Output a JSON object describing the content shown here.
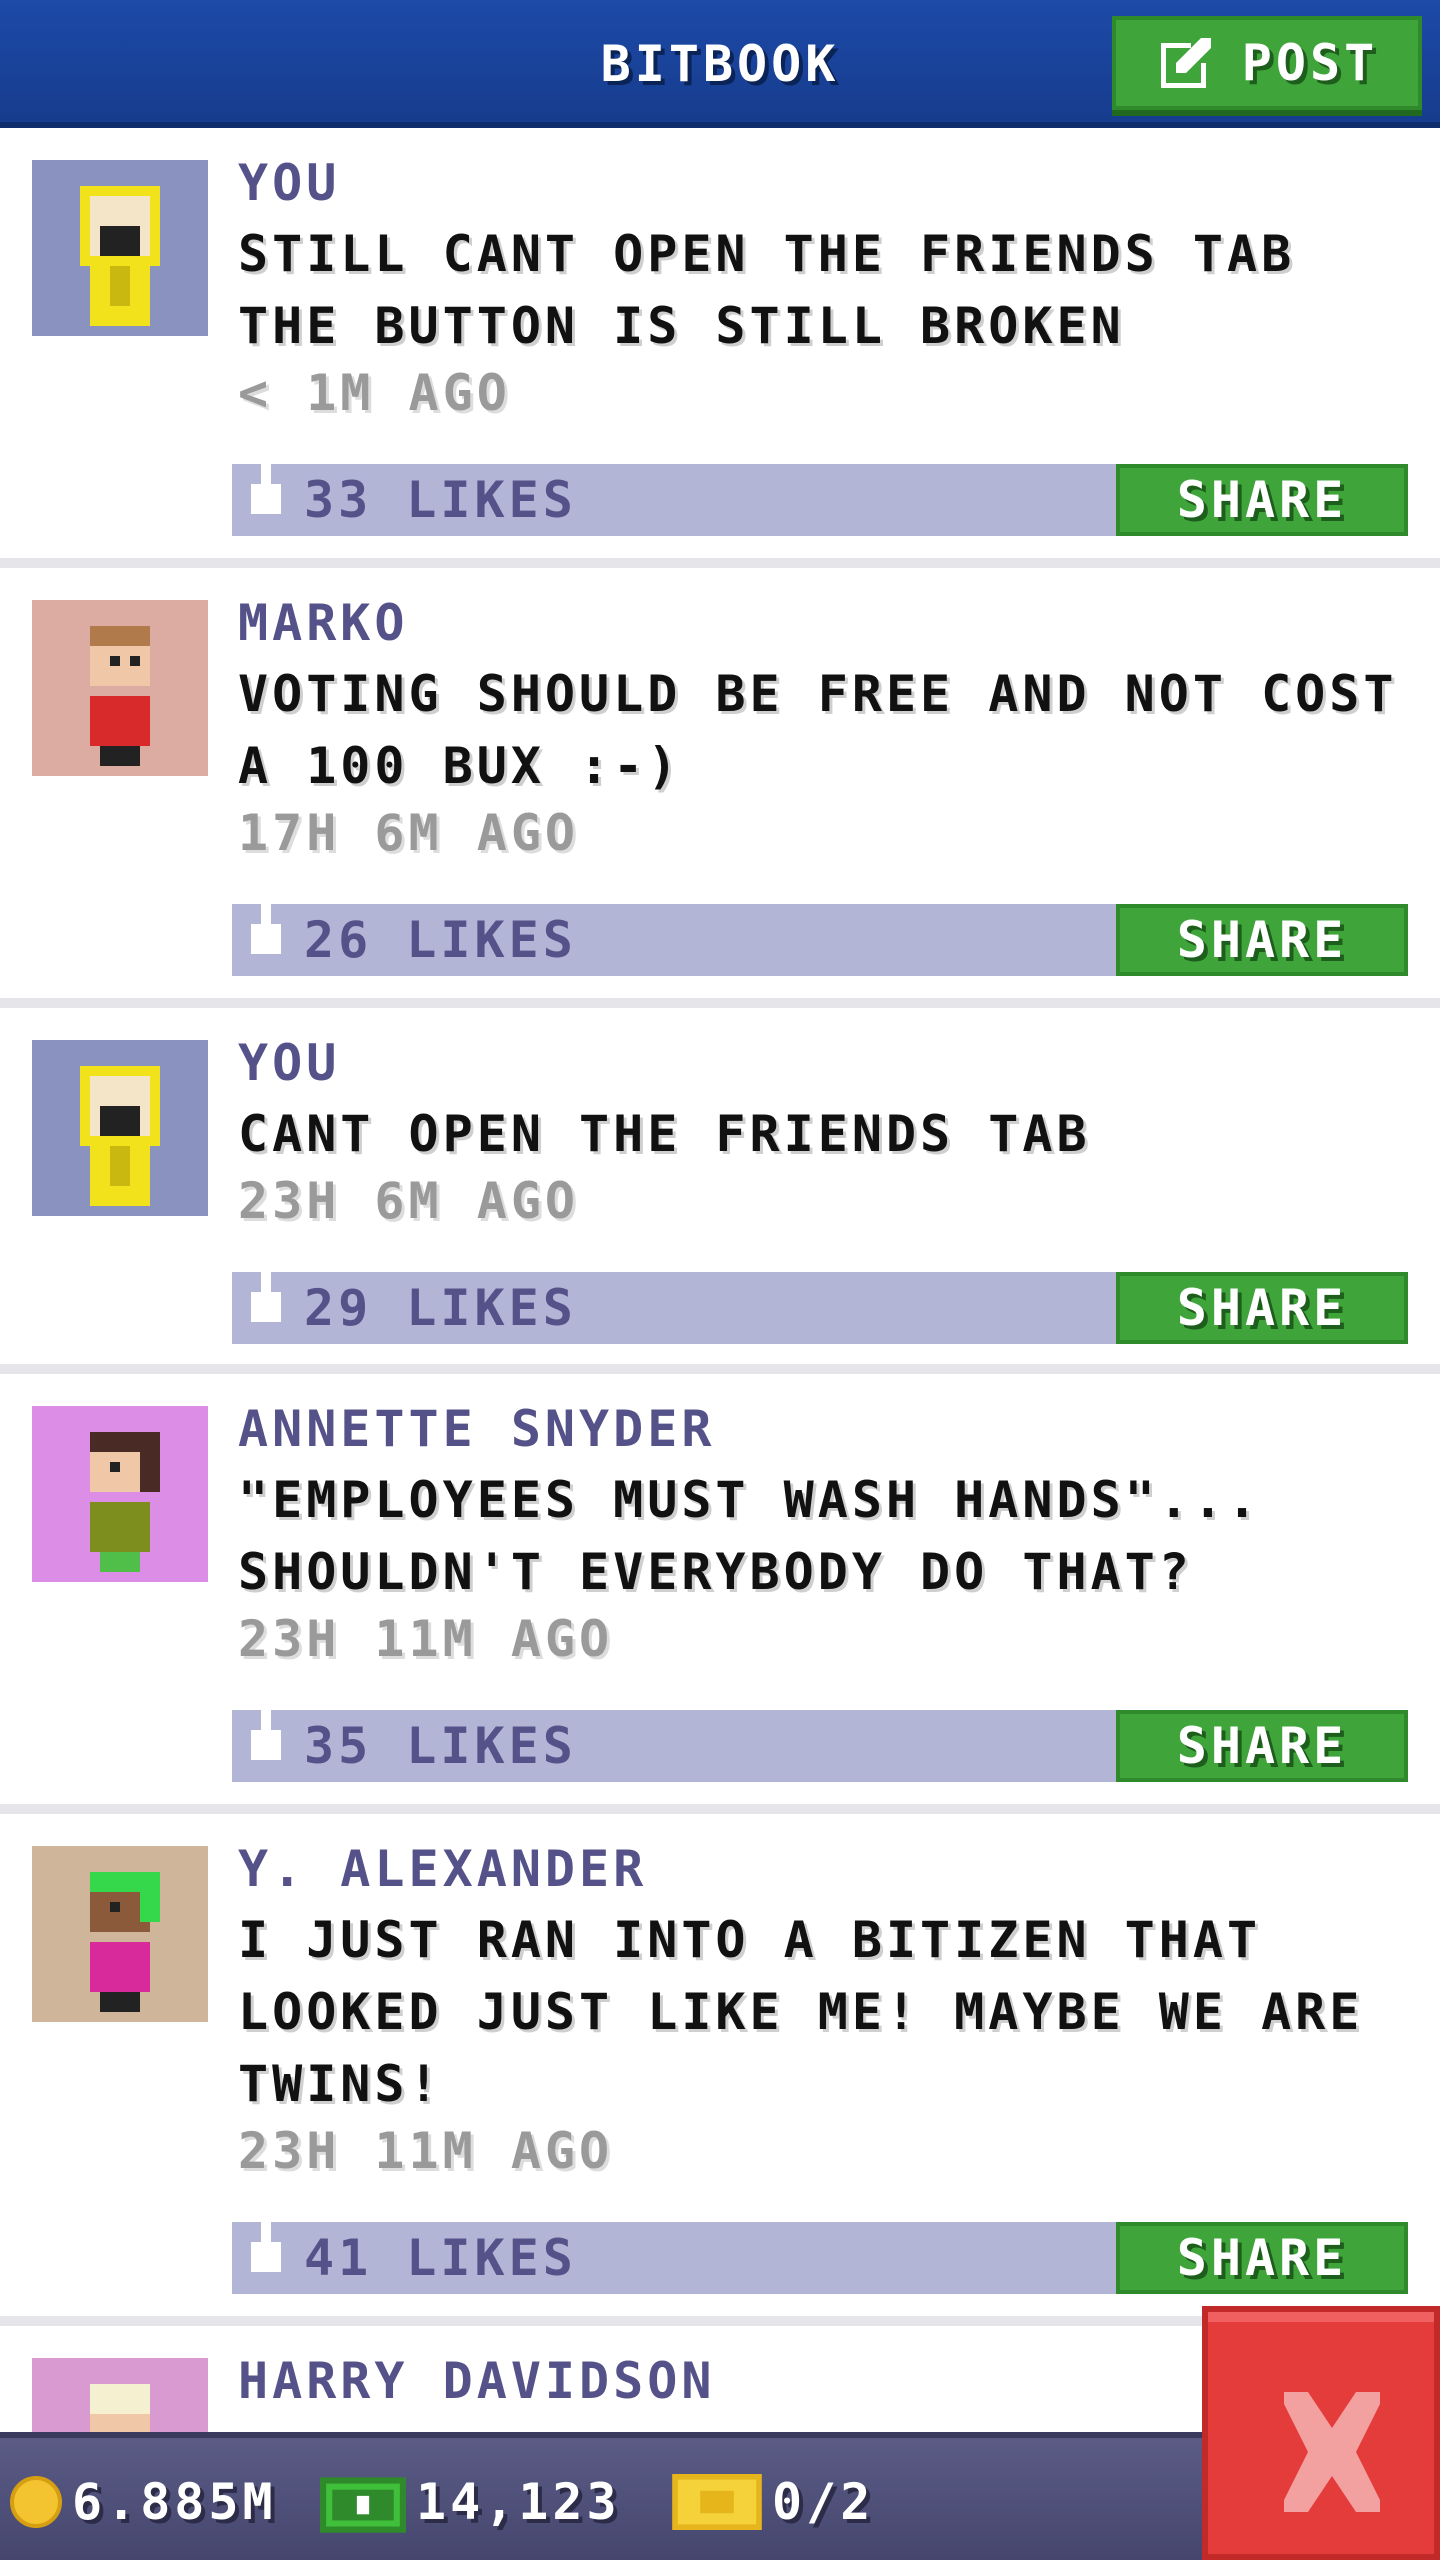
{
  "header": {
    "title": "BITBOOK",
    "post_label": "POST"
  },
  "posts": [
    {
      "author": "YOU",
      "message": "STILL CANT OPEN THE FRIENDS TAB THE BUTTON IS STILL BROKEN",
      "time": "< 1M AGO",
      "likes": "33 LIKES",
      "share": "SHARE",
      "avatar_bg": "#8a93c0"
    },
    {
      "author": "MARKO",
      "message": "VOTING SHOULD BE FREE AND NOT COST A 100 BUX :-)",
      "time": "17H 6M AGO",
      "likes": "26 LIKES",
      "share": "SHARE",
      "avatar_bg": "#dcaca3"
    },
    {
      "author": "YOU",
      "message": "CANT OPEN THE FRIENDS TAB",
      "time": "23H 6M AGO",
      "likes": "29 LIKES",
      "share": "SHARE",
      "avatar_bg": "#8a93c0"
    },
    {
      "author": "ANNETTE SNYDER",
      "message": "\"EMPLOYEES MUST WASH HANDS\"... SHOULDN'T EVERYBODY DO THAT?",
      "time": "23H 11M AGO",
      "likes": "35 LIKES",
      "share": "SHARE",
      "avatar_bg": "#dc8ee6"
    },
    {
      "author": "Y. ALEXANDER",
      "message": "I JUST RAN INTO A BITIZEN THAT LOOKED JUST LIKE ME! MAYBE WE ARE TWINS!",
      "time": "23H 11M AGO",
      "likes": "41 LIKES",
      "share": "SHARE",
      "avatar_bg": "#cfb59a"
    },
    {
      "author": "HARRY DAVIDSON",
      "avatar_bg": "#d89ad0"
    }
  ],
  "status": {
    "coins": "6.885M",
    "bux": "14,123",
    "tickets": "0/2"
  },
  "colors": {
    "header": "#1d4aa8",
    "accent_green": "#3fa53a",
    "like_bar": "#b3b5d6",
    "author": "#55528a",
    "close": "#e43b3b"
  },
  "icons": {
    "post": "edit-icon",
    "like": "thumb-up-icon",
    "coins": "coin-icon",
    "bux": "bux-icon",
    "tickets": "ticket-icon",
    "close": "close-icon"
  }
}
